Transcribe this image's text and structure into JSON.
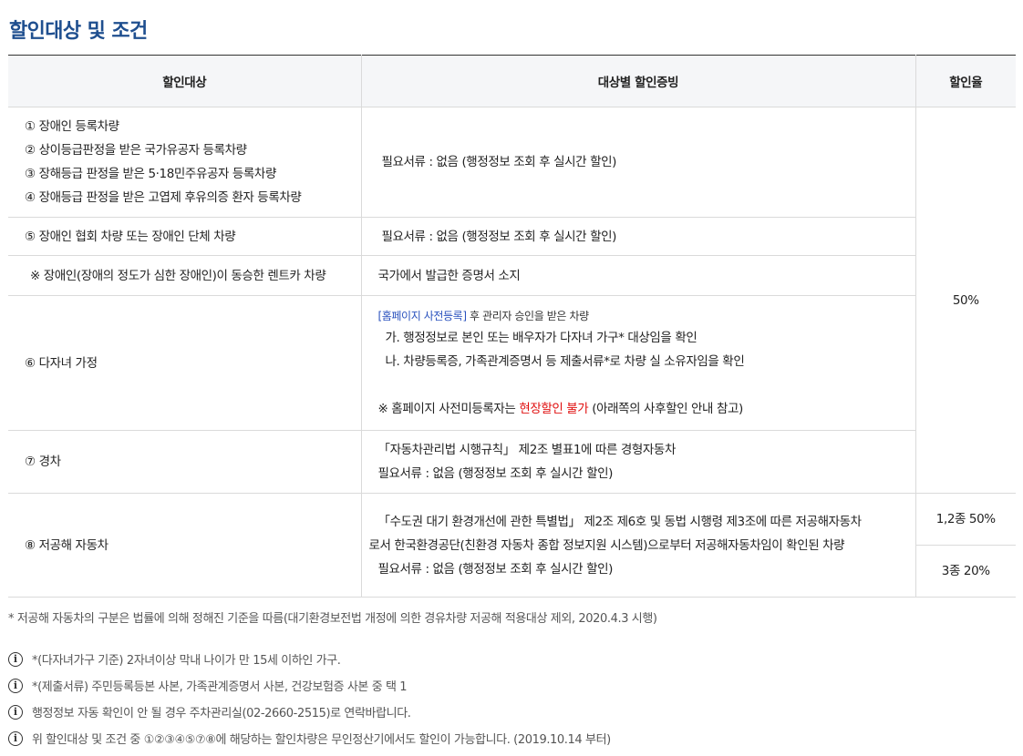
{
  "title": "할인대상 및 조건",
  "table": {
    "headers": [
      "할인대상",
      "대상별 할인증빙",
      "할인율"
    ],
    "rows": {
      "r1": {
        "targets": [
          "① 장애인 등록차량",
          "② 상이등급판정을 받은 국가유공자 등록차량",
          "③ 장해등급 판정을 받은 5·18민주유공자 등록차량",
          "④ 장애등급 판정을 받은 고엽제 후유의증 환자 등록차량"
        ],
        "proof": "필요서류 : 없음 (행정정보 조회 후 실시간 할인)"
      },
      "r2": {
        "target": "⑤ 장애인 협회 차량 또는 장애인 단체 차량",
        "proof": "필요서류 : 없음 (행정정보 조회 후 실시간 할인)"
      },
      "r3": {
        "target": "※ 장애인(장애의 정도가 심한 장애인)이 동승한 렌트카 차량",
        "proof": "국가에서 발급한 증명서 소지"
      },
      "r4": {
        "target": "⑥ 다자녀 가정",
        "proof_link": "[홈페이지 사전등록]",
        "proof_sub": " 후 관리자 승인을 받은 차량",
        "proof_a": "가. 행정정보로 본인 또는 배우자가 다자녀 가구* 대상임을 확인",
        "proof_b": "나. 차량등록증, 가족관계증명서 등 제출서류*로 차량 실 소유자임을 확인",
        "proof_note_pre": "※ 홈페이지 사전미등록자는 ",
        "proof_note_red": "현장할인 불가",
        "proof_note_post": " (아래쪽의 사후할인 안내 참고)"
      },
      "r5": {
        "target": "⑦ 경차",
        "proof_1": "「자동차관리법 시행규칙」 제2조 별표1에 따른 경형자동차",
        "proof_2": "필요서류 : 없음 (행정정보 조회 후 실시간 할인)"
      },
      "r6": {
        "target": "⑧ 저공해 자동차",
        "proof_1": "「수도권 대기 환경개선에 관한 특별법」 제2조 제6호 및 동법 시행령 제3조에 따른 저공해자동차",
        "proof_2": "로서 한국환경공단(친환경 자동차 종합 정보지원 시스템)으로부터 저공해자동차임이 확인된 차량",
        "proof_3": "필요서류 : 없음 (행정정보 조회 후 실시간 할인)"
      }
    },
    "rate_main": "50%",
    "rate_low_1": "1,2종 50%",
    "rate_low_2": "3종 20%"
  },
  "note": "* 저공해 자동차의 구분은 법률에 의해 정해진 기준을 따름(대기환경보전법 개정에 의한 경유차량 저공해 적용대상 제외, 2020.4.3 시행)",
  "info": [
    "*(다자녀가구 기준) 2자녀이상 막내 나이가 만 15세 이하인 가구.",
    "*(제출서류) 주민등록등본 사본, 가족관계증명서 사본, 건강보험증 사본 중 택 1",
    "행정정보 자동 확인이 안 될 경우 주차관리실(02-2660-2515)로 연락바랍니다.",
    "위 할인대상 및 조건 중 ①②③④⑤⑦⑧에 해당하는 할인차량은 무인정산기에서도 할인이 가능합니다. (2019.10.14 부터)"
  ],
  "info_icon": "info-circle-icon"
}
